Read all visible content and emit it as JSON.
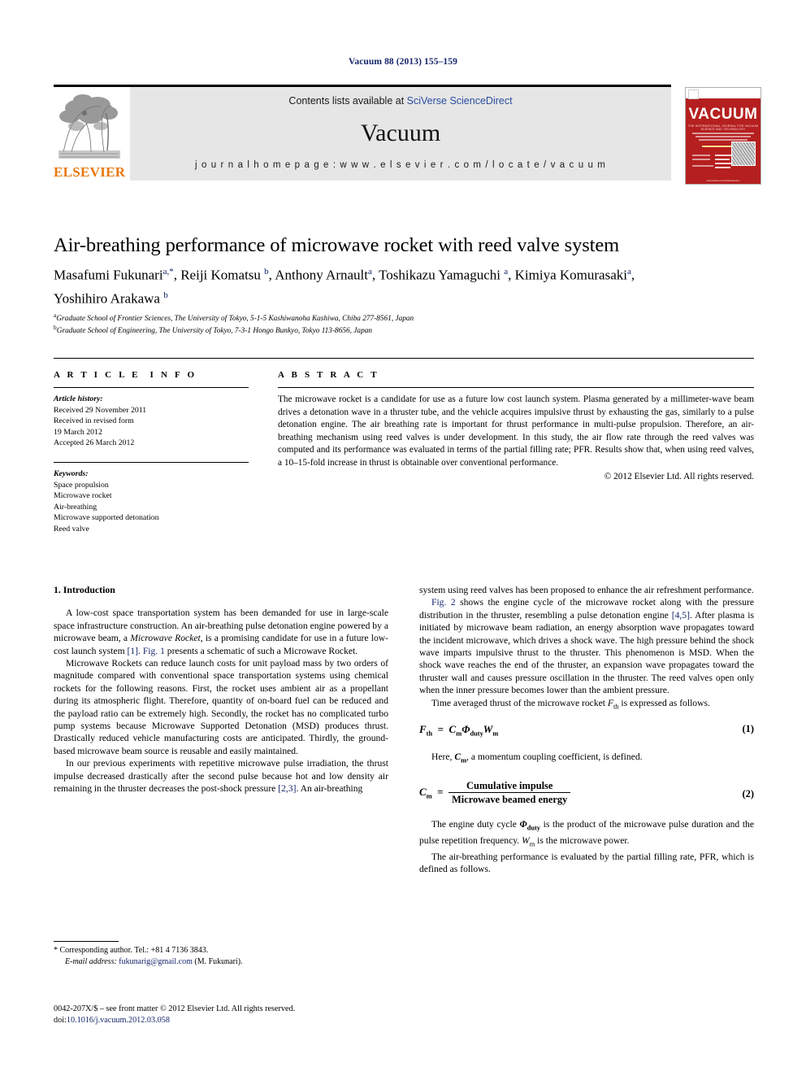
{
  "running_head": "Vacuum 88 (2013) 155–159",
  "masthead": {
    "contents_prefix": "Contents lists available at ",
    "contents_link": "SciVerse ScienceDirect",
    "journal_title": "Vacuum",
    "homepage": "j o u r n a l   h o m e p a g e :   w w w . e l s e v i e r . c o m / l o c a t e / v a c u u m",
    "publisher": "ELSEVIER"
  },
  "cover": {
    "title": "VACUUM",
    "subtitle": "THE INTERNATIONAL JOURNAL FOR VACUUM SCIENCE AND TECHNOLOGY",
    "top_left": "ELSEVIER",
    "bottom": "www.elsevier.com/locate/vacuum"
  },
  "article": {
    "title": "Air-breathing performance of microwave rocket with reed valve system",
    "authors_line1": "Masafumi Fukunari a,*, Reiji Komatsu b, Anthony Arnault a, Toshikazu Yamaguchi a, Kimiya Komurasaki a,",
    "authors_line2": "Yoshihiro Arakawa b",
    "affiliation_a": "Graduate School of Frontier Sciences, The University of Tokyo, 5-1-5 Kashiwanoha Kashiwa, Chiba 277-8561, Japan",
    "affiliation_b": "Graduate School of Engineering, The University of Tokyo, 7-3-1 Hongo Bunkyo, Tokyo 113-8656, Japan"
  },
  "info": {
    "heading": "ARTICLE INFO",
    "history_label": "Article history:",
    "history": [
      "Received 29 November 2011",
      "Received in revised form",
      "19 March 2012",
      "Accepted 26 March 2012"
    ],
    "keywords_label": "Keywords:",
    "keywords": [
      "Space propulsion",
      "Microwave rocket",
      "Air-breathing",
      "Microwave supported detonation",
      "Reed valve"
    ]
  },
  "abstract": {
    "heading": "ABSTRACT",
    "text": "The microwave rocket is a candidate for use as a future low cost launch system. Plasma generated by a millimeter-wave beam drives a detonation wave in a thruster tube, and the vehicle acquires impulsive thrust by exhausting the gas, similarly to a pulse detonation engine. The air breathing rate is important for thrust performance in multi-pulse propulsion. Therefore, an air-breathing mechanism using reed valves is under development. In this study, the air flow rate through the reed valves was computed and its performance was evaluated in terms of the partial filling rate; PFR. Results show that, when using reed valves, a 10–15-fold increase in thrust is obtainable over conventional performance.",
    "copyright": "© 2012 Elsevier Ltd. All rights reserved."
  },
  "body": {
    "section_title": "1. Introduction",
    "left_paragraphs": [
      "A low-cost space transportation system has been demanded for use in large-scale space infrastructure construction. An air-breathing pulse detonation engine powered by a microwave beam, a Microwave Rocket, is a promising candidate for use in a future low-cost launch system [1]. Fig. 1 presents a schematic of such a Microwave Rocket.",
      "Microwave Rockets can reduce launch costs for unit payload mass by two orders of magnitude compared with conventional space transportation systems using chemical rockets for the following reasons. First, the rocket uses ambient air as a propellant during its atmospheric flight. Therefore, quantity of on-board fuel can be reduced and the payload ratio can be extremely high. Secondly, the rocket has no complicated turbo pump systems because Microwave Supported Detonation (MSD) produces thrust. Drastically reduced vehicle manufacturing costs are anticipated. Thirdly, the ground-based microwave beam source is reusable and easily maintained.",
      "In our previous experiments with repetitive microwave pulse irradiation, the thrust impulse decreased drastically after the second pulse because hot and low density air remaining in the thruster decreases the post-shock pressure [2,3]. An air-breathing"
    ],
    "right_paragraphs": [
      "system using reed valves has been proposed to enhance the air refreshment performance.",
      "Fig. 2 shows the engine cycle of the microwave rocket along with the pressure distribution in the thruster, resembling a pulse detonation engine [4,5]. After plasma is initiated by microwave beam radiation, an energy absorption wave propagates toward the incident microwave, which drives a shock wave. The high pressure behind the shock wave imparts impulsive thrust to the thruster. This phenomenon is MSD. When the shock wave reaches the end of the thruster, an expansion wave propagates toward the thruster wall and causes pressure oscillation in the thruster. The reed valves open only when the inner pressure becomes lower than the ambient pressure.",
      "Time averaged thrust of the microwave rocket Fth is expressed as follows.",
      "Here, Cm, a momentum coupling coefficient, is defined.",
      "The engine duty cycle Φduty is the product of the microwave pulse duration and the pulse repetition frequency. Wm is the microwave power.",
      "The air-breathing performance is evaluated by the partial filling rate, PFR, which is defined as follows."
    ],
    "equations": {
      "eq1_number": "(1)",
      "eq2_number": "(2)",
      "eq2_numerator": "Cumulative impulse",
      "eq2_denominator": "Microwave beamed energy"
    }
  },
  "footnotes": {
    "corresponding": "* Corresponding author. Tel.: +81 4 7136 3843.",
    "email_label": "E-mail address:",
    "email": "fukunarig@gmail.com",
    "email_owner": "(M. Fukunari).",
    "frontmatter": "0042-207X/$ – see front matter © 2012 Elsevier Ltd. All rights reserved.",
    "doi_label": "doi:",
    "doi": "10.1016/j.vacuum.2012.03.058"
  },
  "colors": {
    "link": "#16256b",
    "sciencedirect": "#2b4ea2",
    "elsevier_orange": "#e8770d",
    "cover_red": "#b51f1f",
    "masthead_grey": "#e6e6e6"
  }
}
